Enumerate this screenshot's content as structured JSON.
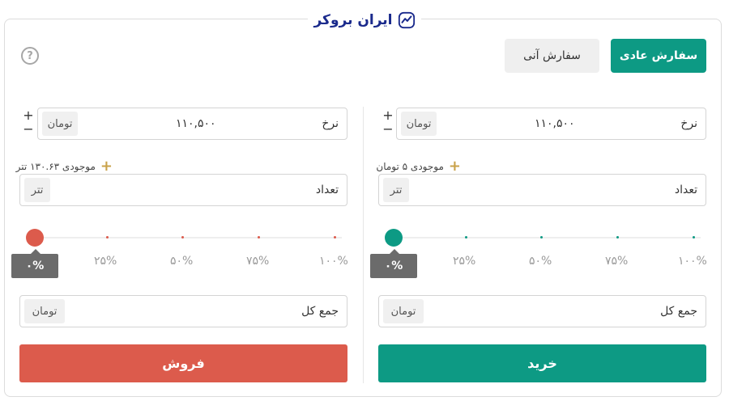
{
  "brand": {
    "name": "ایران بروکر"
  },
  "order_types": {
    "normal": "سفارش عادی",
    "instant": "سفارش آنی"
  },
  "buy": {
    "price_label": "نرخ",
    "price_value": "۱۱۰,۵۰۰",
    "price_unit": "تومان",
    "balance": "موجودی ۵ تومان",
    "amount_label": "تعداد",
    "amount_unit": "تتر",
    "slider_value": "۰%",
    "total_label": "جمع کل",
    "total_unit": "تومان",
    "button": "خرید",
    "color": "#0d9a84"
  },
  "sell": {
    "price_label": "نرخ",
    "price_value": "۱۱۰,۵۰۰",
    "price_unit": "تومان",
    "balance": "موجودی ۱۳۰.۶۳ تتر",
    "amount_label": "تعداد",
    "amount_unit": "تتر",
    "slider_value": "۰%",
    "total_label": "جمع کل",
    "total_unit": "تومان",
    "button": "فروش",
    "color": "#dc5b4c"
  },
  "slider_marks": [
    "۲۵%",
    "۵۰%",
    "۷۵%",
    "۱۰۰%"
  ],
  "stepper": {
    "plus": "+",
    "minus": "−"
  },
  "icons": {
    "help": "?",
    "balance_add": "+",
    "logo": "chart-trend-icon"
  }
}
